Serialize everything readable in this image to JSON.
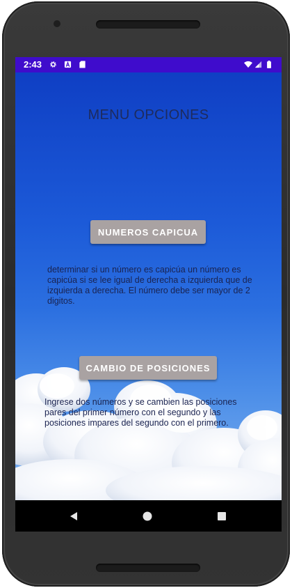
{
  "status_bar": {
    "time": "2:43",
    "left_icons": [
      "gear-icon",
      "a-square-icon",
      "sd-card-icon"
    ],
    "right_icons": [
      "wifi-icon",
      "signal-icon",
      "battery-icon"
    ],
    "color": "#3f0ccc"
  },
  "page": {
    "title": "MENU OPCIONES"
  },
  "options": [
    {
      "button_label": "NUMEROS CAPICUA",
      "description": "determinar si un número es capicúa un número es capicúa si se lee igual de derecha a izquierda que de izquierda a derecha. El número debe ser mayor de 2 digitos."
    },
    {
      "button_label": "CAMBIO DE POSICIONES",
      "description": "Ingrese dos números y se cambien las posiciones pares del primer número con el segundo y las posiciones impares del segundo con el primero."
    }
  ],
  "nav_bar": {
    "buttons": [
      "back-icon",
      "home-icon",
      "recents-icon"
    ]
  },
  "colors": {
    "button": "#a9a2a2",
    "background_top": "#0f3fc4"
  }
}
